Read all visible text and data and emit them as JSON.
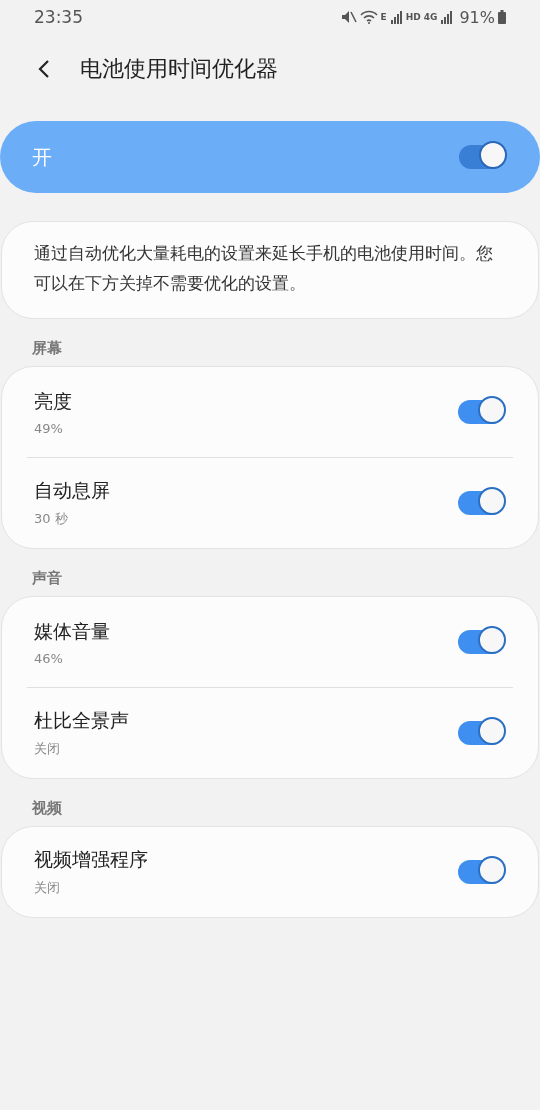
{
  "status_bar": {
    "time": "23:35",
    "network_labels": [
      "E",
      "HD",
      "4G"
    ],
    "battery": "91%"
  },
  "header": {
    "title": "电池使用时间优化器"
  },
  "master_switch": {
    "label": "开",
    "on": true
  },
  "description": "通过自动优化大量耗电的设置来延长手机的电池使用时间。您可以在下方关掉不需要优化的设置。",
  "sections": [
    {
      "title": "屏幕",
      "items": [
        {
          "title": "亮度",
          "summary": "49%",
          "on": true
        },
        {
          "title": "自动息屏",
          "summary": "30 秒",
          "on": true
        }
      ]
    },
    {
      "title": "声音",
      "items": [
        {
          "title": "媒体音量",
          "summary": "46%",
          "on": true
        },
        {
          "title": "杜比全景声",
          "summary": "关闭",
          "on": true
        }
      ]
    },
    {
      "title": "视频",
      "items": [
        {
          "title": "视频增强程序",
          "summary": "关闭",
          "on": true
        }
      ]
    }
  ]
}
